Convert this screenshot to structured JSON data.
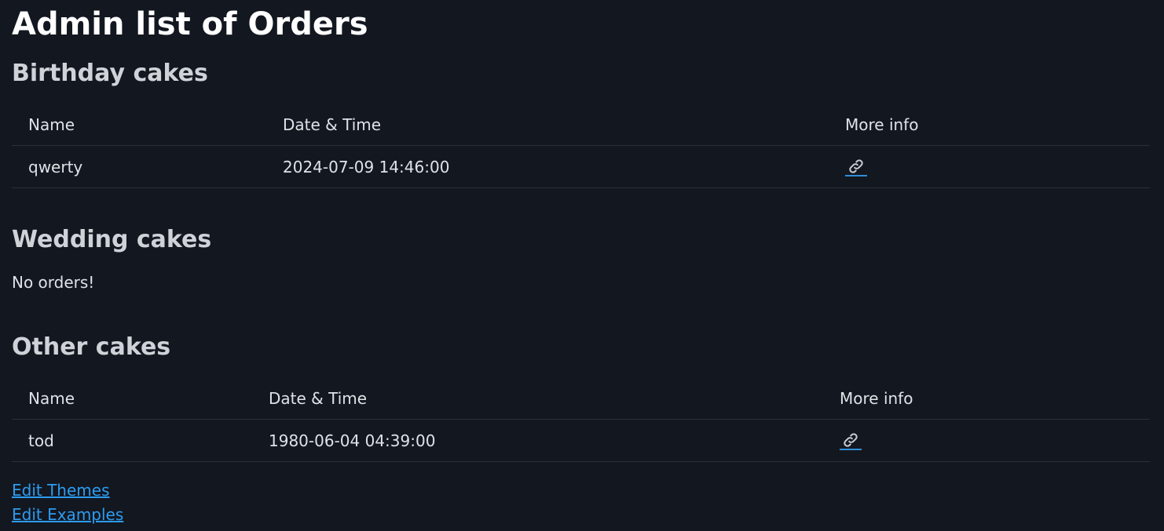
{
  "page_title": "Admin list of Orders",
  "sections": {
    "birthday": {
      "title": "Birthday cakes",
      "columns": [
        "Name",
        "Date & Time",
        "More info"
      ],
      "rows": [
        {
          "name": "qwerty",
          "datetime": "2024-07-09 14:46:00",
          "more_info_icon": "link-icon"
        }
      ]
    },
    "wedding": {
      "title": "Wedding cakes",
      "empty_message": "No orders!"
    },
    "other": {
      "title": "Other cakes",
      "columns": [
        "Name",
        "Date & Time",
        "More info"
      ],
      "rows": [
        {
          "name": "tod",
          "datetime": "1980-06-04 04:39:00",
          "more_info_icon": "link-icon"
        }
      ]
    }
  },
  "footer_links": {
    "edit_themes": "Edit Themes",
    "edit_examples": "Edit Examples"
  },
  "colors": {
    "background": "#131720",
    "text": "#dfe2e6",
    "heading": "#ffffff",
    "link": "#2d9cf0",
    "row_border": "#2a2f38"
  }
}
